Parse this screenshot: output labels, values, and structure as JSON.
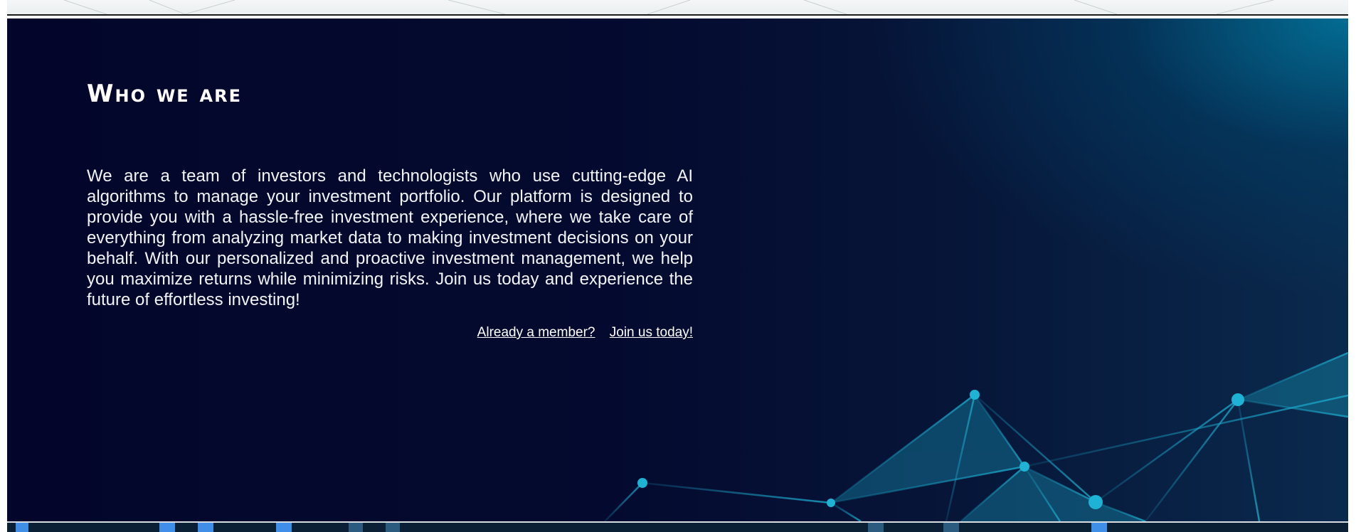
{
  "hero": {
    "title": "Who we are",
    "description": "We are a team of investors and technologists who use cutting-edge AI algorithms to manage your investment portfolio. Our platform is designed to provide you with a hassle-free investment experience, where we take care of everything from analyzing market data to making investment decisions on your behalf. With our personalized and proactive investment management, we help you maximize returns while minimizing risks. Join us today and experience the future of effortless investing!",
    "links": {
      "member": "Already a member?",
      "join": "Join us today!"
    }
  },
  "colors": {
    "hero_background": "#03062a",
    "accent_glow": "#0082aa",
    "network_line": "#1aa3c4",
    "text": "#ffffff"
  },
  "icons": {
    "network_decoration": "network-graphic-icon"
  }
}
